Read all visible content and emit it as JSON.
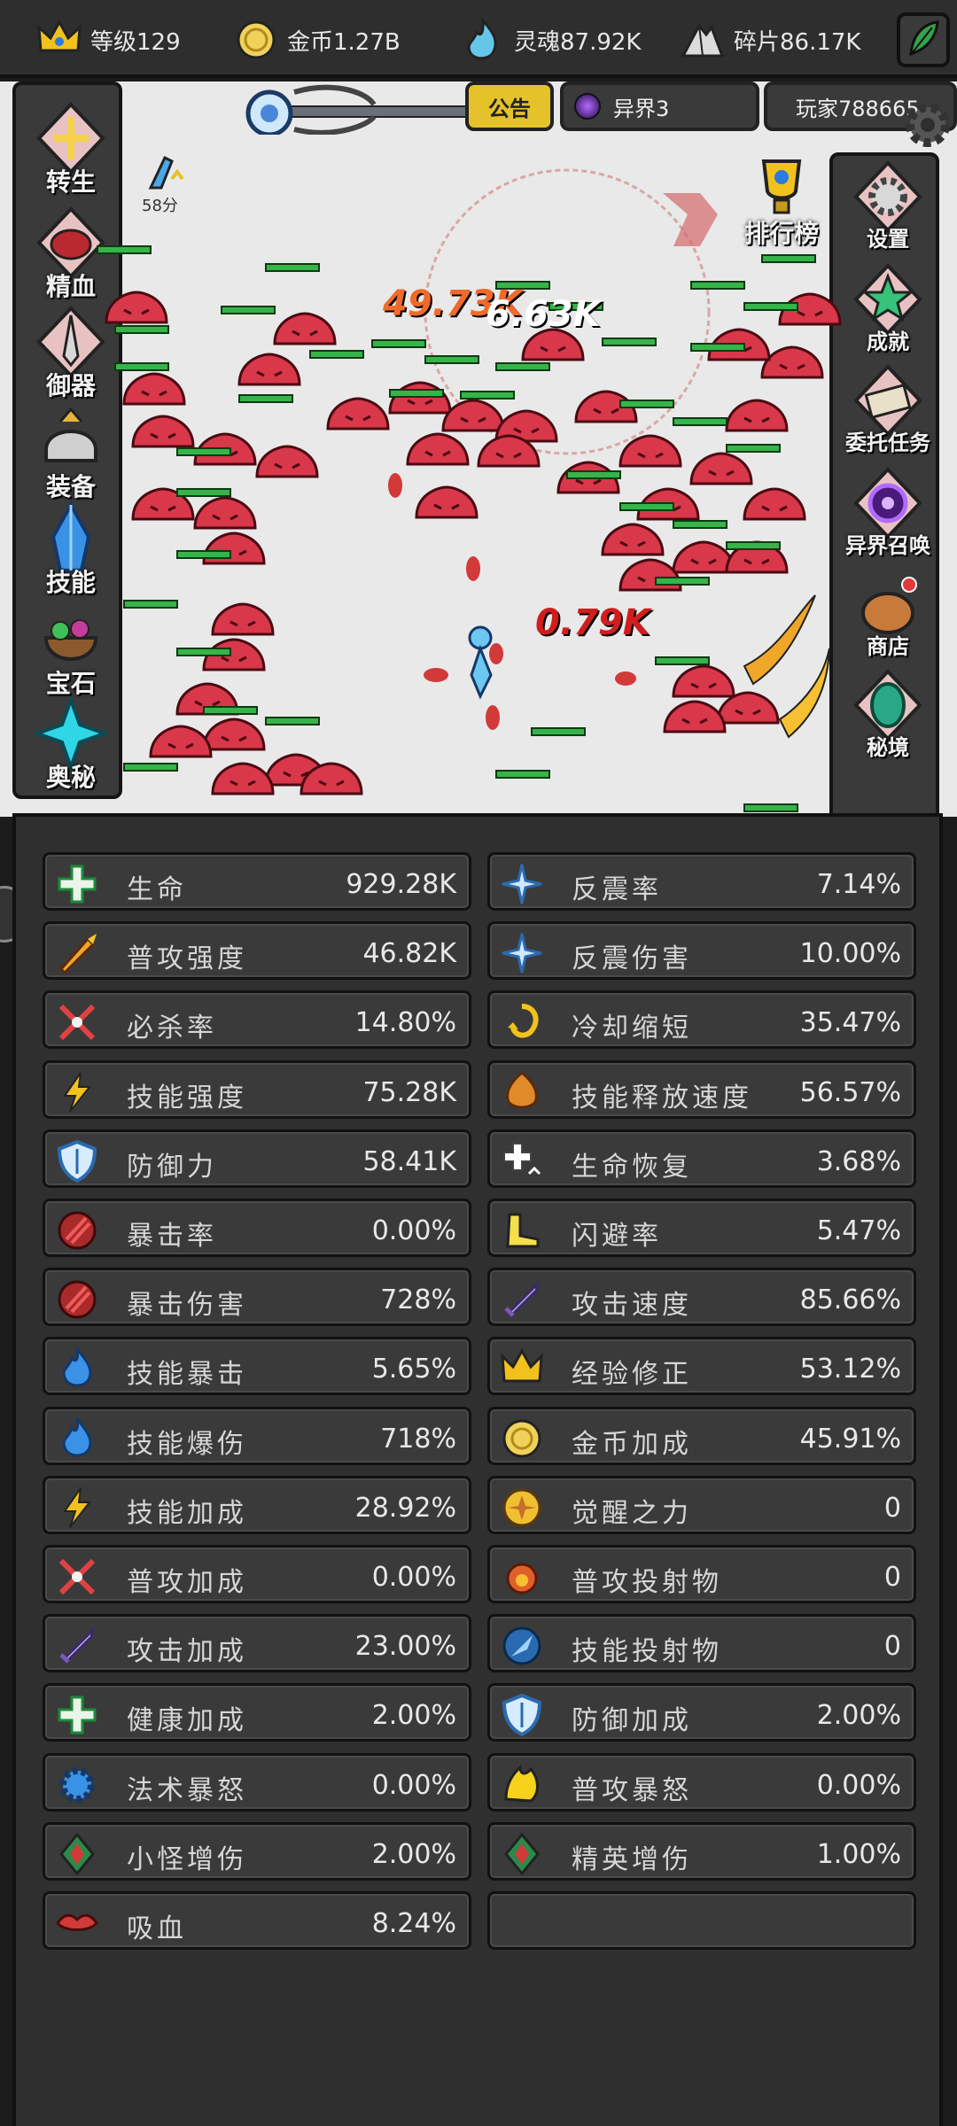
{
  "resources": [
    {
      "label": "等级129",
      "icon": "crown-icon"
    },
    {
      "label": "金币1.27B",
      "icon": "coin-icon"
    },
    {
      "label": "灵魂87.92K",
      "icon": "soul-icon"
    },
    {
      "label": "碎片86.17K",
      "icon": "shard-icon"
    }
  ],
  "hud": {
    "notice_label": "公告",
    "world_label": "异界3",
    "player_label": "玩家788665",
    "timer_label": "58分"
  },
  "left_menu": [
    "转生",
    "精血",
    "御器",
    "装备",
    "技能",
    "宝石",
    "奥秘"
  ],
  "right_menu": [
    "排行榜",
    "设置",
    "成就",
    "委托任务",
    "异界召唤",
    "商店",
    "秘境"
  ],
  "damage_numbers": [
    "49.73K",
    "6.63K",
    "0.79K"
  ],
  "stats": [
    {
      "name": "生命",
      "value": "929.28K",
      "icon": "health-cross-icon"
    },
    {
      "name": "反震率",
      "value": "7.14%",
      "icon": "ice-shard-icon"
    },
    {
      "name": "普攻强度",
      "value": "46.82K",
      "icon": "flame-arrow-icon"
    },
    {
      "name": "反震伤害",
      "value": "10.00%",
      "icon": "ice-shard-icon"
    },
    {
      "name": "必杀率",
      "value": "14.80%",
      "icon": "crossed-sword-icon"
    },
    {
      "name": "冷却缩短",
      "value": "35.47%",
      "icon": "cooldown-swirl-icon"
    },
    {
      "name": "技能强度",
      "value": "75.28K",
      "icon": "lightning-icon"
    },
    {
      "name": "技能释放速度",
      "value": "56.57%",
      "icon": "fire-shield-icon"
    },
    {
      "name": "防御力",
      "value": "58.41K",
      "icon": "shield-icon"
    },
    {
      "name": "生命恢复",
      "value": "3.68%",
      "icon": "regen-cross-icon"
    },
    {
      "name": "暴击率",
      "value": "0.00%",
      "icon": "crit-claw-icon"
    },
    {
      "name": "闪避率",
      "value": "5.47%",
      "icon": "boot-icon"
    },
    {
      "name": "暴击伤害",
      "value": "728%",
      "icon": "crit-claw-icon"
    },
    {
      "name": "攻击速度",
      "value": "85.66%",
      "icon": "sword-icon"
    },
    {
      "name": "技能暴击",
      "value": "5.65%",
      "icon": "blue-flame-icon"
    },
    {
      "name": "经验修正",
      "value": "53.12%",
      "icon": "crown-icon"
    },
    {
      "name": "技能爆伤",
      "value": "718%",
      "icon": "blue-flame-icon"
    },
    {
      "name": "金币加成",
      "value": "45.91%",
      "icon": "coin-icon"
    },
    {
      "name": "技能加成",
      "value": "28.92%",
      "icon": "lightning-icon"
    },
    {
      "name": "觉醒之力",
      "value": "0",
      "icon": "sun-medal-icon"
    },
    {
      "name": "普攻加成",
      "value": "0.00%",
      "icon": "crossed-sword-icon"
    },
    {
      "name": "普攻投射物",
      "value": "0",
      "icon": "fireball-icon"
    },
    {
      "name": "攻击加成",
      "value": "23.00%",
      "icon": "sword-icon"
    },
    {
      "name": "技能投射物",
      "value": "0",
      "icon": "blue-dart-icon"
    },
    {
      "name": "健康加成",
      "value": "2.00%",
      "icon": "health-cross-icon"
    },
    {
      "name": "防御加成",
      "value": "2.00%",
      "icon": "shield-icon"
    },
    {
      "name": "法术暴怒",
      "value": "0.00%",
      "icon": "blue-gear-icon"
    },
    {
      "name": "普攻暴怒",
      "value": "0.00%",
      "icon": "yellow-flame-icon"
    },
    {
      "name": "小怪增伤",
      "value": "2.00%",
      "icon": "emblem-icon"
    },
    {
      "name": "精英增伤",
      "value": "1.00%",
      "icon": "emblem-icon"
    },
    {
      "name": "吸血",
      "value": "8.24%",
      "icon": "lips-icon"
    },
    {
      "name": "",
      "value": "",
      "icon": ""
    }
  ]
}
